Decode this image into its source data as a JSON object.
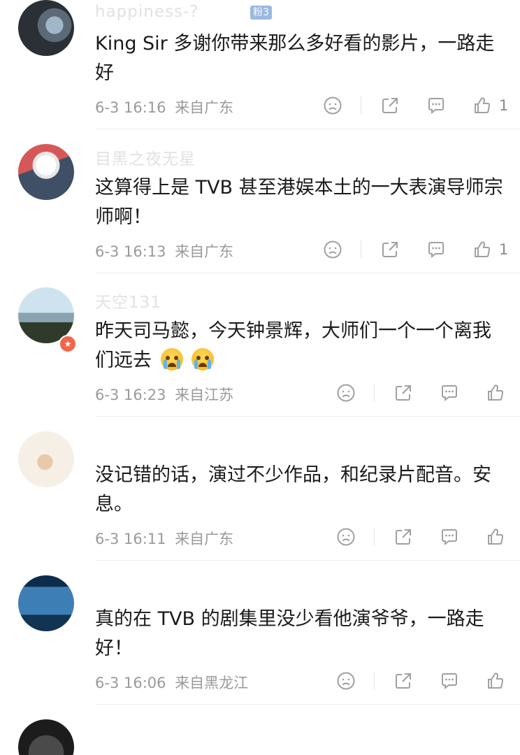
{
  "comments": [
    {
      "username": "happiness-?",
      "fan_badge": "粉3",
      "text": "King Sir 多谢你带来那么多好看的影片，一路走好",
      "time": "6-3 16:16",
      "source": "来自广东",
      "like_count": "1"
    },
    {
      "username": "目黑之夜无星",
      "text": "这算得上是 TVB 甚至港娱本土的一大表演导师宗师啊！",
      "time": "6-3 16:13",
      "source": "来自广东",
      "like_count": "1"
    },
    {
      "username": "天空131",
      "text": "昨天司马懿，今天钟景辉，大师们一个一个离我们远去",
      "time": "6-3 16:23",
      "source": "来自江苏",
      "like_count": ""
    },
    {
      "username": "",
      "text": "没记错的话，演过不少作品，和纪录片配音。安息。",
      "time": "6-3 16:11",
      "source": "来自广东",
      "like_count": ""
    },
    {
      "username": "",
      "text": "真的在 TVB 的剧集里没少看他演爷爷，一路走好！",
      "time": "6-3 16:06",
      "source": "来自黑龙江",
      "like_count": ""
    }
  ],
  "icons": {
    "dislike": "frown-icon",
    "share": "share-icon",
    "comment": "comment-icon",
    "like": "thumbs-up-icon"
  },
  "colors": {
    "text": "#1a1a1a",
    "meta": "#9a9a9a",
    "icon": "#a0a0a0",
    "verified_badge": "#f0654b"
  }
}
